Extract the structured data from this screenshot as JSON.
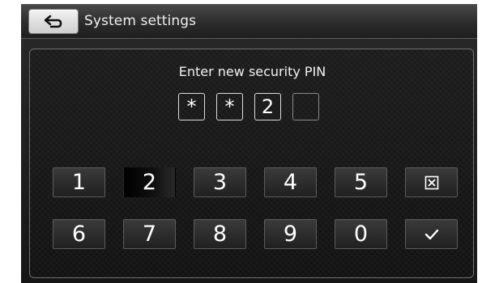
{
  "window": {
    "title": "System settings"
  },
  "header": {
    "back_icon": "return-arrow-icon"
  },
  "pin_entry": {
    "prompt": "Enter new security PIN",
    "digits": [
      "*",
      "*",
      "2",
      ""
    ]
  },
  "keypad": {
    "rows": [
      [
        "1",
        "2",
        "3",
        "4",
        "5"
      ],
      [
        "6",
        "7",
        "8",
        "9",
        "0"
      ]
    ],
    "pressed_key": "2",
    "delete_icon": "clear-box-icon",
    "confirm_icon": "checkmark-icon"
  },
  "colors": {
    "background": "#161616",
    "text": "#ffffff",
    "key_border": "#5c5c5c"
  }
}
